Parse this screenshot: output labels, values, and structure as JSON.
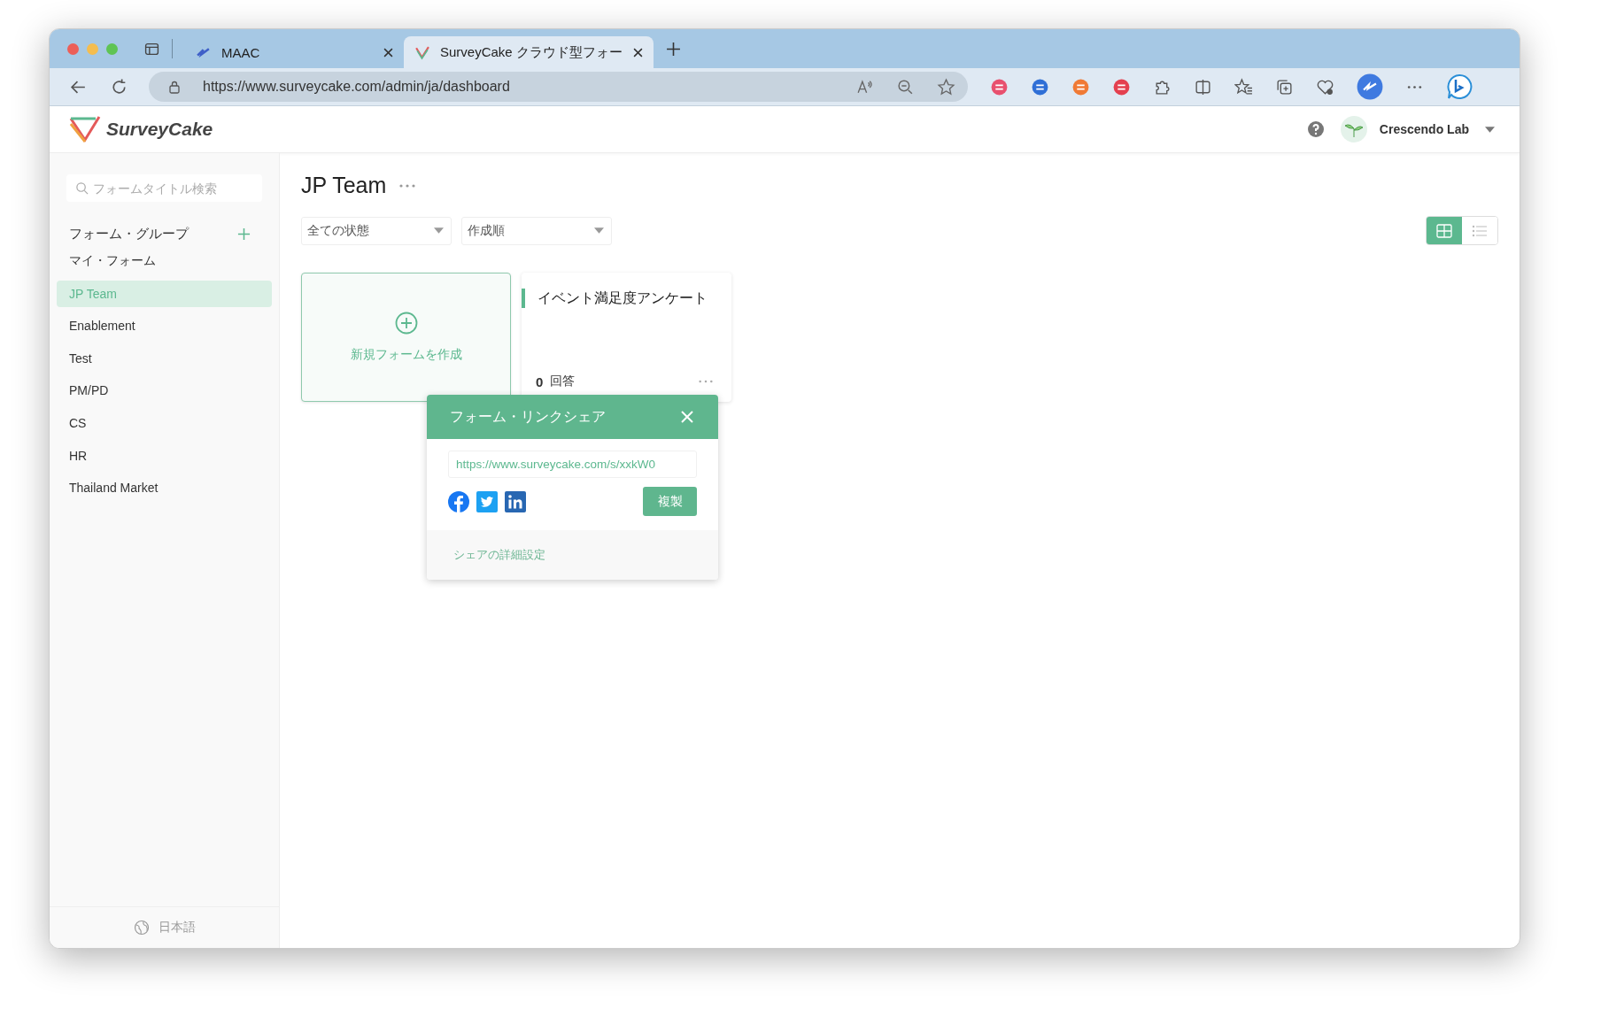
{
  "browser": {
    "tabs": [
      {
        "title": "MAAC",
        "selected": false
      },
      {
        "title": "SurveyCake クラウド型フォー",
        "selected": true
      }
    ],
    "address": "https://www.surveycake.com/admin/ja/dashboard"
  },
  "header": {
    "logo": "SurveyCake",
    "account": "Crescendo Lab"
  },
  "sidebar": {
    "search": {
      "placeholder": "フォームタイトル検索"
    },
    "heading": "フォーム・グループ",
    "items": [
      {
        "label": "マイ・フォーム",
        "selected": false
      },
      {
        "label": "JP Team",
        "selected": true
      },
      {
        "label": "Enablement",
        "selected": false
      },
      {
        "label": "Test",
        "selected": false
      },
      {
        "label": "PM/PD",
        "selected": false
      },
      {
        "label": "CS",
        "selected": false
      },
      {
        "label": "HR",
        "selected": false
      },
      {
        "label": "Thailand Market",
        "selected": false
      }
    ],
    "language": "日本語"
  },
  "main": {
    "title": "JP Team",
    "filters": [
      "全ての状態",
      "作成順"
    ],
    "views": [
      {
        "kind": "grid",
        "selected": true
      },
      {
        "kind": "list",
        "selected": false
      }
    ],
    "new_form": "新規フォームを作成",
    "forms": [
      {
        "title": "イベント満足度アンケート",
        "count": "0",
        "unit": "回答"
      }
    ]
  },
  "share_popup": {
    "title": "フォーム・リンクシェア",
    "url": "https://www.surveycake.com/s/xxkW0",
    "copy_button": "複製",
    "footer_link": "シェアの詳細設定"
  }
}
